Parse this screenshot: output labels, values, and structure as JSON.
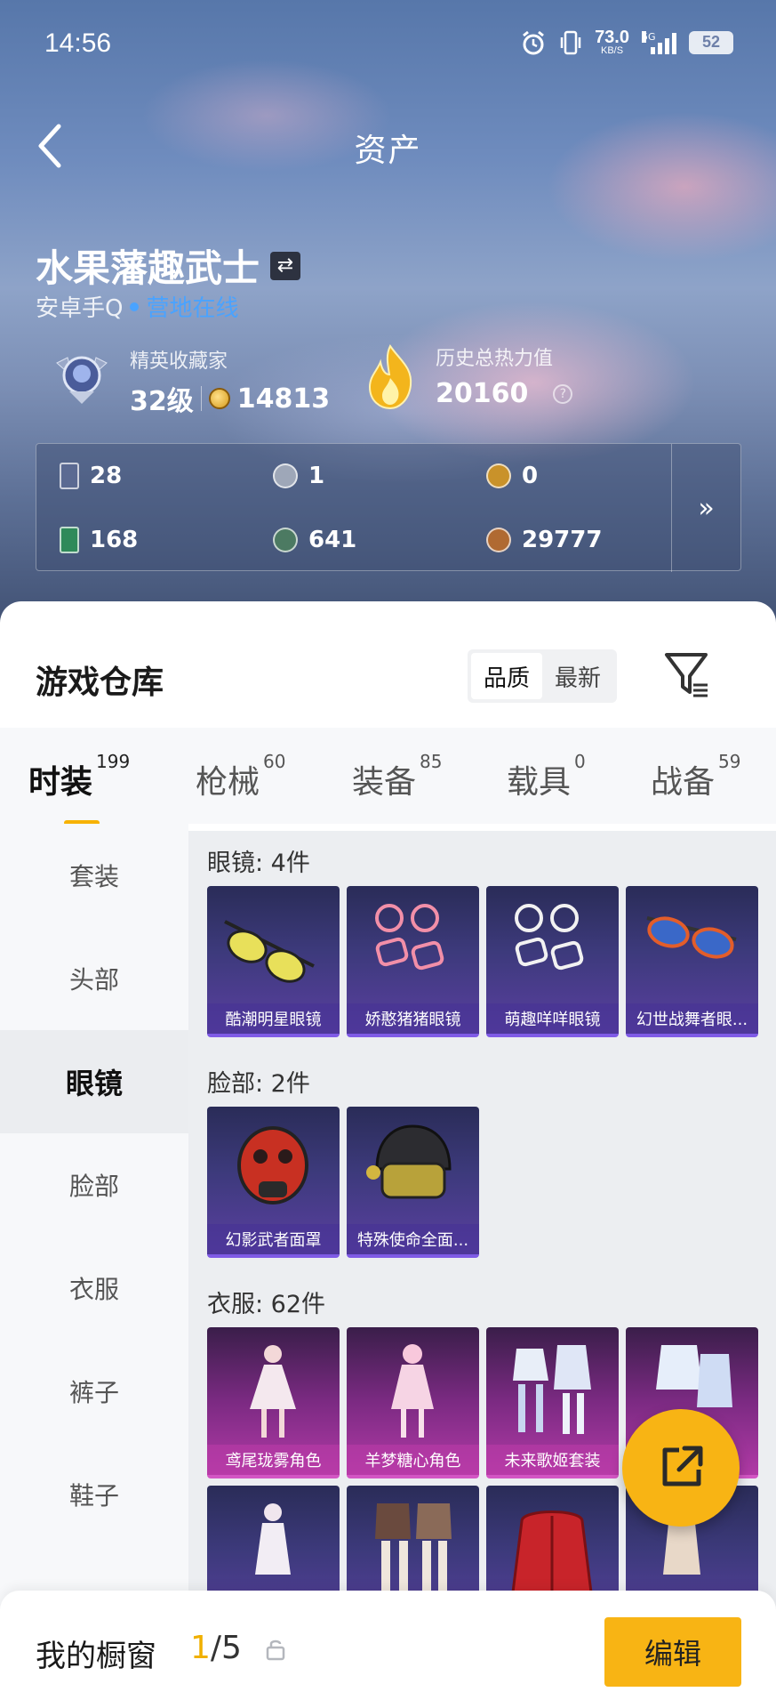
{
  "status": {
    "time": "14:56",
    "net_speed": "73.0",
    "net_unit": "KB/S",
    "network": "5G",
    "battery": "52"
  },
  "header": {
    "title": "资产"
  },
  "profile": {
    "name": "水果藩趣武士",
    "platform": "安卓手Q",
    "online": "营地在线",
    "rank_label": "精英收藏家",
    "level": "32级",
    "points": "14813",
    "heat_label": "历史总热力值",
    "heat_value": "20160",
    "help": "?"
  },
  "currencies": [
    {
      "icon": "card-icon",
      "value": "28",
      "color": "#5b6a92"
    },
    {
      "icon": "silver-coin-icon",
      "value": "1",
      "color": "#9ea7b8"
    },
    {
      "icon": "gold-emblem-icon",
      "value": "0",
      "color": "#c9922a"
    },
    {
      "icon": "green-card-icon",
      "value": "168",
      "color": "#2f8a5a"
    },
    {
      "icon": "green-coin-icon",
      "value": "641",
      "color": "#4c7a62"
    },
    {
      "icon": "bronze-coin-icon",
      "value": "29777",
      "color": "#b06a32"
    }
  ],
  "currency_more": "»",
  "warehouse": {
    "title": "游戏仓库",
    "sort_options": [
      "品质",
      "最新"
    ],
    "sort_selected": "品质"
  },
  "tabs": [
    {
      "label": "时装",
      "count": "199",
      "active": true
    },
    {
      "label": "枪械",
      "count": "60"
    },
    {
      "label": "装备",
      "count": "85"
    },
    {
      "label": "载具",
      "count": "0"
    },
    {
      "label": "战备",
      "count": "59"
    }
  ],
  "sidebar": [
    "套装",
    "头部",
    "眼镜",
    "脸部",
    "衣服",
    "裤子",
    "鞋子"
  ],
  "sidebar_selected": "眼镜",
  "sections": [
    {
      "title": "眼镜: 4件",
      "items": [
        "酷潮明星眼镜",
        "娇憨猪猪眼镜",
        "萌趣咩咩眼镜",
        "幻世战舞者眼..."
      ]
    },
    {
      "title": "脸部: 2件",
      "items": [
        "幻影武者面罩",
        "特殊使命全面..."
      ]
    },
    {
      "title": "衣服: 62件",
      "items": [
        "鸢尾珑雾角色",
        "羊梦糖心角色",
        "未来歌姬套装",
        "",
        "",
        "",
        "",
        ""
      ]
    }
  ],
  "showcase": {
    "label": "我的橱窗",
    "current": "1",
    "total": "/5",
    "edit": "编辑"
  },
  "colors": {
    "accent": "#f8b414",
    "online": "#4aa3ff",
    "rare_purple": "#7f5be6",
    "rare_pink": "#d356c4"
  }
}
